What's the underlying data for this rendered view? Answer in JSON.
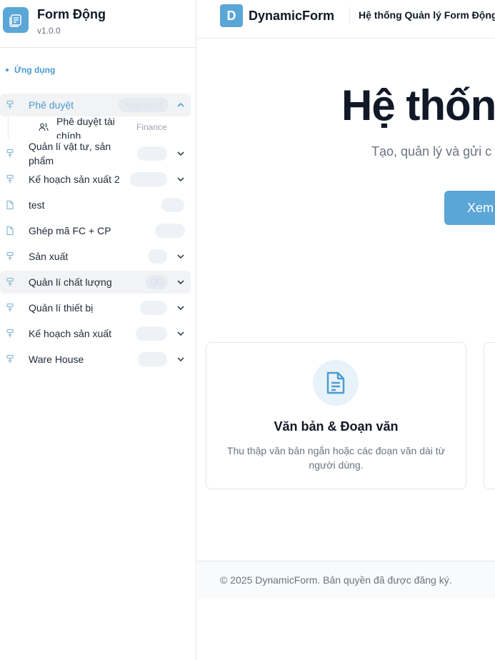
{
  "sidebar": {
    "app_name": "Form Động",
    "version": "v1.0.0",
    "group_label": "Ứng dụng",
    "items": [
      {
        "label": "Phê duyệt",
        "badge": "Approved",
        "icon": "workflow-icon",
        "expandable": true,
        "expanded": true,
        "active": true
      },
      {
        "label": "Quản lí vật tư, sản phẩm",
        "badge": "",
        "icon": "workflow-icon",
        "expandable": true
      },
      {
        "label": "Kế hoạch sản xuất 2",
        "badge": "",
        "icon": "workflow-icon",
        "expandable": true
      },
      {
        "label": "test",
        "badge": "",
        "icon": "file-icon",
        "expandable": false
      },
      {
        "label": "Ghép mã FC + CP",
        "badge": "",
        "icon": "file-icon",
        "expandable": false
      },
      {
        "label": "Sản xuất",
        "badge": "",
        "icon": "workflow-icon",
        "expandable": true
      },
      {
        "label": "Quản lí chất lượng",
        "badge": "QC",
        "icon": "workflow-icon",
        "expandable": true
      },
      {
        "label": "Quản lí thiết bị",
        "badge": "",
        "icon": "workflow-icon",
        "expandable": true
      },
      {
        "label": "Kế hoạch sản xuất",
        "badge": "",
        "icon": "workflow-icon",
        "expandable": true
      },
      {
        "label": "Ware House",
        "badge": "",
        "icon": "workflow-icon",
        "expandable": true
      }
    ],
    "sub_items": [
      {
        "label": "Phê duyệt tài chính",
        "badge": "Finance",
        "icon": "users-icon"
      }
    ]
  },
  "topbar": {
    "logo_letter": "D",
    "brand": "DynamicForm",
    "title": "Hệ thống Quản lý Form Động"
  },
  "hero": {
    "title": "Hệ thống",
    "subtitle": "Tạo, quản lý và gửi c",
    "button_label": "Xem"
  },
  "cards": [
    {
      "title": "Văn bản & Đoạn văn",
      "description": "Thu thập văn bản ngắn hoặc các đoạn văn dài từ người dùng.",
      "icon": "document-icon"
    }
  ],
  "footer": {
    "text": "© 2025 DynamicForm. Bản quyền đã được đăng ký."
  },
  "colors": {
    "accent": "#5aa6d6",
    "accent_text": "#4b9bd0",
    "badge_bg": "#eef2f6"
  }
}
